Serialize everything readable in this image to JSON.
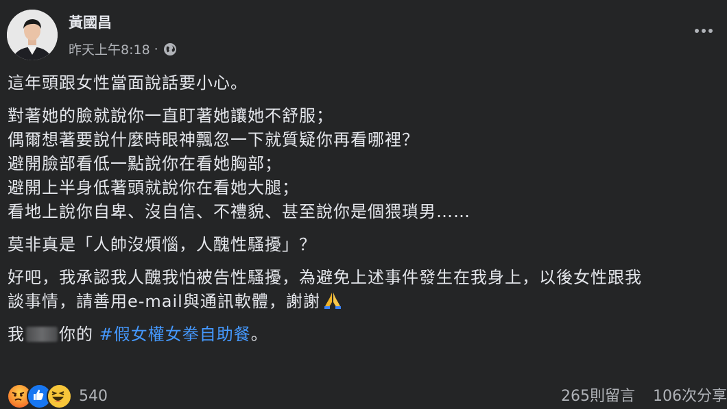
{
  "post": {
    "author": "黃國昌",
    "time": "昨天上午8:18",
    "separator": "·",
    "privacy_icon": "globe-icon",
    "more_icon": "more-options-icon"
  },
  "content": {
    "p1": "這年頭跟女性當面說話要小心。",
    "p2": [
      "對著她的臉就說你一直盯著她讓她不舒服；",
      "偶爾想著要說什麼時眼神飄忽一下就質疑你再看哪裡？",
      "避開臉部看低一點說你在看她胸部；",
      "避開上半身低著頭就說你在看她大腿；",
      "看地上說你自卑、沒自信、不禮貌、甚至說你是個猥瑣男……"
    ],
    "p3": "莫非真是「人帥沒煩惱，人醜性騷擾」？",
    "p4_line1": "好吧，我承認我人醜我怕被告性騷擾，為避免上述事件發生在我身上，以後女性跟我",
    "p4_line2": "談事情，請善用e-mail與通訊軟體，謝謝",
    "pray_icon": "folded-hands-icon",
    "p5_prefix": "我",
    "p5_middle": "你的",
    "hashtag": "#假女權女拳自助餐",
    "p5_suffix": "。"
  },
  "footer": {
    "reactions": [
      "angry-icon",
      "like-icon",
      "haha-icon"
    ],
    "reaction_count": "540",
    "comments": "265則留言",
    "shares": "106次分享"
  },
  "colors": {
    "background": "#242526",
    "text": "#e4e6eb",
    "secondary": "#b0b3b8",
    "link": "#4599ff",
    "like": "#1877f2"
  }
}
